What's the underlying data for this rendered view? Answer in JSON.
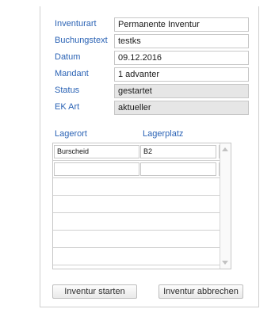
{
  "form": {
    "fields": [
      {
        "label": "Inventurart",
        "value": "Permanente Inventur",
        "readonly": false
      },
      {
        "label": "Buchungstext",
        "value": "testks",
        "readonly": false
      },
      {
        "label": "Datum",
        "value": "09.12.2016",
        "readonly": false
      },
      {
        "label": "Mandant",
        "value": "1 advanter",
        "readonly": false
      },
      {
        "label": "Status",
        "value": "gestartet",
        "readonly": true
      },
      {
        "label": "EK Art",
        "value": "aktueller",
        "readonly": true
      }
    ]
  },
  "grid": {
    "columns": [
      "Lagerort",
      "Lagerplatz"
    ],
    "rows": [
      {
        "lagerort": "Burscheid",
        "lagerplatz": "B2",
        "action": "-"
      },
      {
        "lagerort": "",
        "lagerplatz": "",
        "action": "-"
      }
    ]
  },
  "buttons": {
    "start": "Inventur starten",
    "cancel": "Inventur abbrechen"
  },
  "colors": {
    "label": "#2b63b5",
    "readonly_bg": "#e6e6e6"
  }
}
